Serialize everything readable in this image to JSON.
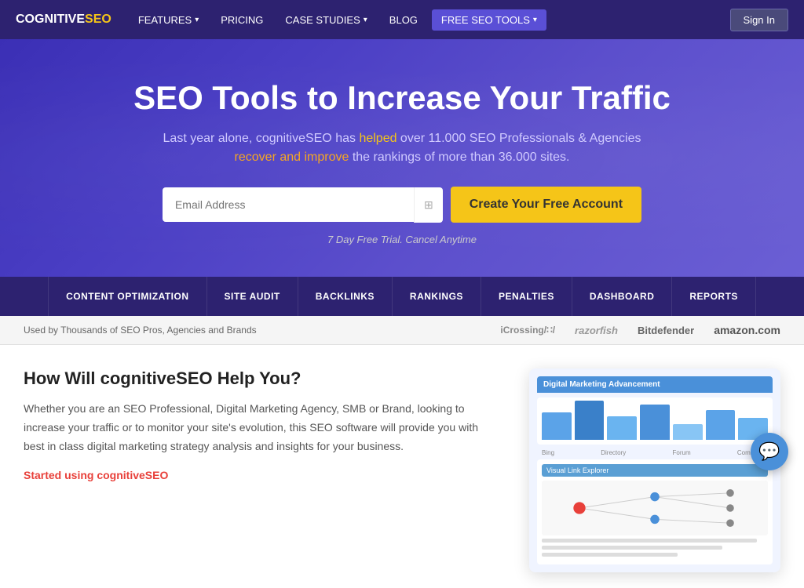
{
  "brand": {
    "cognitive": "COGNITIVE",
    "seo": "SEO",
    "full": "COGNITIVESEO"
  },
  "navbar": {
    "features_label": "FEATURES",
    "pricing_label": "PRICING",
    "case_studies_label": "CASE STUDIES",
    "blog_label": "BLOG",
    "free_seo_tools_label": "FREE SEO TOOLS",
    "sign_in_label": "Sign In"
  },
  "hero": {
    "title": "SEO Tools to Increase Your Traffic",
    "subtitle_line1": "Last year alone, cognitiveSEO has helped over 11.000 SEO Professionals & Agencies",
    "subtitle_line2_pre": "",
    "subtitle_line2_highlight": "recover and improve",
    "subtitle_line2_post": " the rankings of more than 36.000 sites.",
    "email_placeholder": "Email Address",
    "cta_button": "Create Your Free Account",
    "trial_text": "7 Day Free Trial. Cancel Anytime"
  },
  "features_bar": {
    "items": [
      "CONTENT OPTIMIZATION",
      "SITE AUDIT",
      "BACKLINKS",
      "RANKINGS",
      "PENALTIES",
      "DASHBOARD",
      "REPORTS"
    ]
  },
  "trusted_bar": {
    "text": "Used by Thousands of SEO Pros, Agencies and Brands",
    "logos": [
      "iCrossing/∷/",
      "razorfish",
      "Bitdefender",
      "amazon.com"
    ]
  },
  "main": {
    "title": "How Will cognitiveSEO Help You?",
    "description": "Whether you are an SEO Professional, Digital Marketing Agency, SMB or Brand, looking to increase your traffic or to monitor your site's evolution, this SEO software will provide you with best in class digital marketing strategy analysis and insights for your business.",
    "link_text": "Started using cognitiveSEO"
  },
  "dashboard": {
    "top_label": "Digital Marketing Advancement",
    "bar_labels": [
      "Bing",
      "Directory",
      "Forum",
      "Commerce"
    ],
    "bottom_label": "Visual Link Explorer"
  },
  "chat": {
    "icon": "💬"
  }
}
